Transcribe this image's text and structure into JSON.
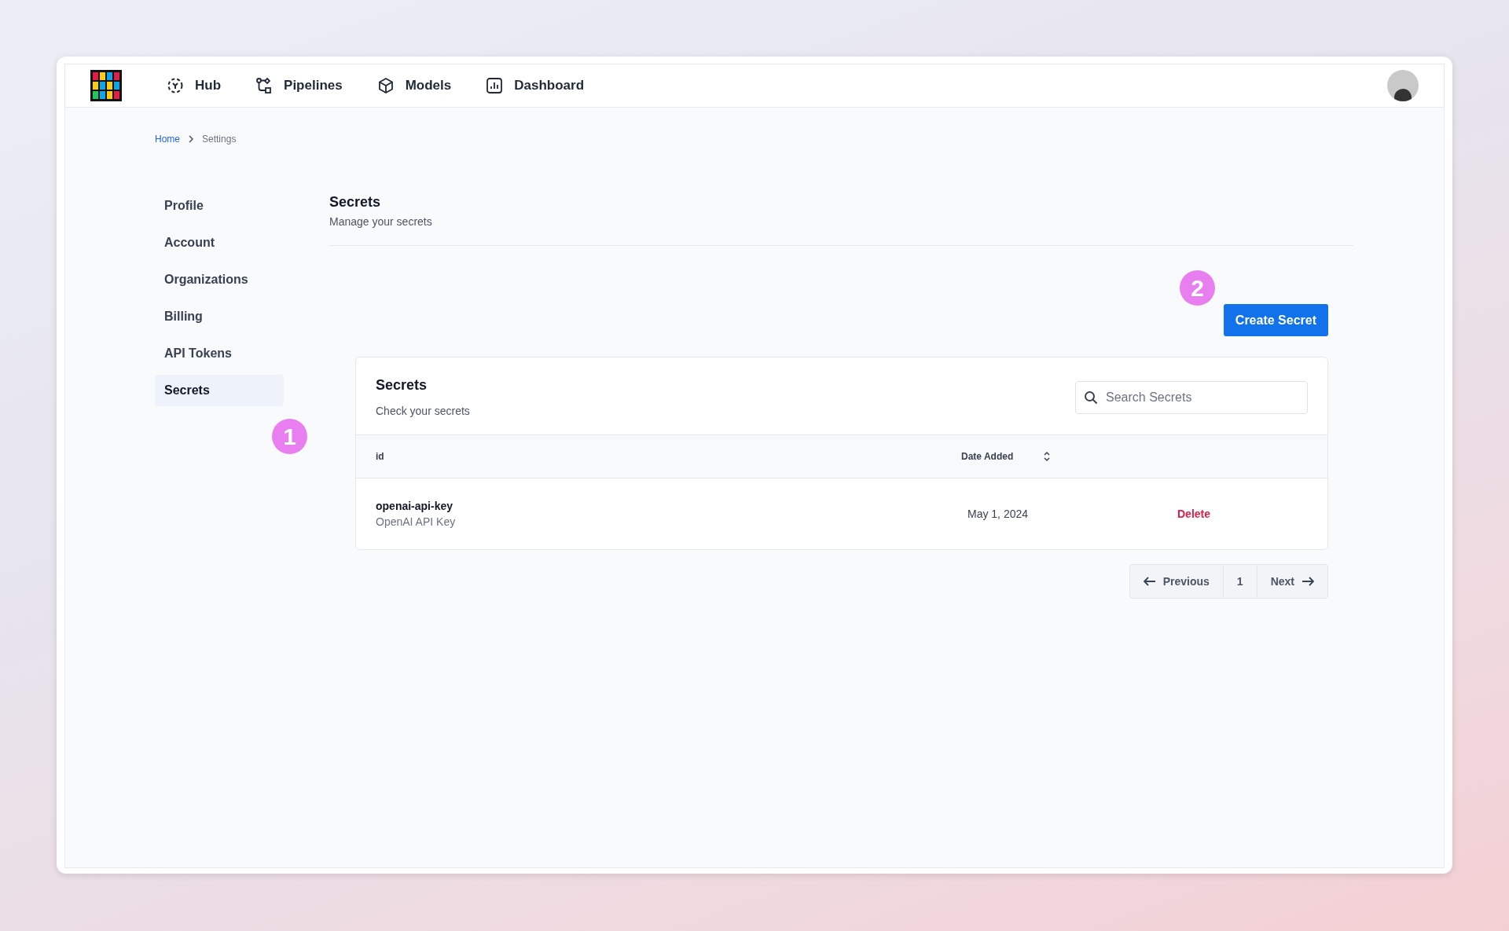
{
  "nav": {
    "items": [
      {
        "label": "Hub",
        "kind": "hub"
      },
      {
        "label": "Pipelines",
        "kind": "pipelines"
      },
      {
        "label": "Models",
        "kind": "models"
      },
      {
        "label": "Dashboard",
        "kind": "dashboard"
      }
    ]
  },
  "breadcrumb": [
    "Home",
    "Settings"
  ],
  "sidebar": {
    "items": [
      {
        "label": "Profile",
        "selected": false
      },
      {
        "label": "Account",
        "selected": false
      },
      {
        "label": "Organizations",
        "selected": false
      },
      {
        "label": "Billing",
        "selected": false
      },
      {
        "label": "API Tokens",
        "selected": false
      },
      {
        "label": "Secrets",
        "selected": true
      }
    ]
  },
  "header": {
    "title": "Secrets",
    "subtitle": "Manage your secrets"
  },
  "create_button": "Create Secret",
  "card": {
    "title": "Secrets",
    "subtitle": "Check your secrets",
    "search": {
      "placeholder": "Search Secrets"
    },
    "columns": [
      "id",
      "Date Added"
    ],
    "rows": [
      {
        "id": "openai-api-key",
        "description": "OpenAI API Key",
        "date": "May 1, 2024",
        "action": "Delete"
      }
    ]
  },
  "pagination": {
    "previous": "Previous",
    "page": "1",
    "next": "Next"
  },
  "annotations": [
    "1",
    "2"
  ]
}
